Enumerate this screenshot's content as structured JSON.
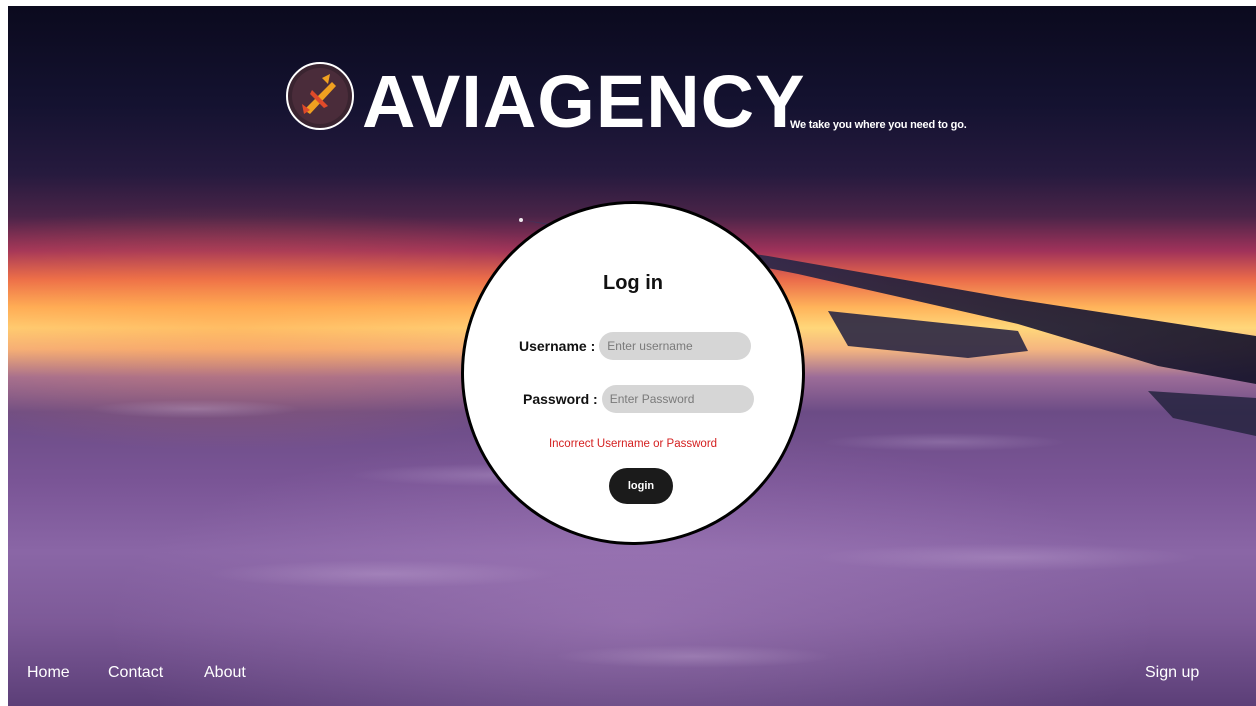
{
  "brand": {
    "name": "AVIAGENCY",
    "tagline": "We take you where you need to go."
  },
  "login": {
    "title": "Log in",
    "username_label": "Username :",
    "username_placeholder": "Enter username",
    "password_label": "Password :",
    "password_placeholder": "Enter Password",
    "error": "Incorrect Username or Password",
    "button_label": "login"
  },
  "nav": {
    "home": "Home",
    "contact": "Contact",
    "about": "About",
    "signup": "Sign up"
  },
  "colors": {
    "error": "#d42020",
    "button_bg": "#1b1b1b",
    "input_bg": "#d6d6d6",
    "logo_accent": "#f0a020"
  },
  "icons": {
    "logo": "airplane-icon"
  }
}
